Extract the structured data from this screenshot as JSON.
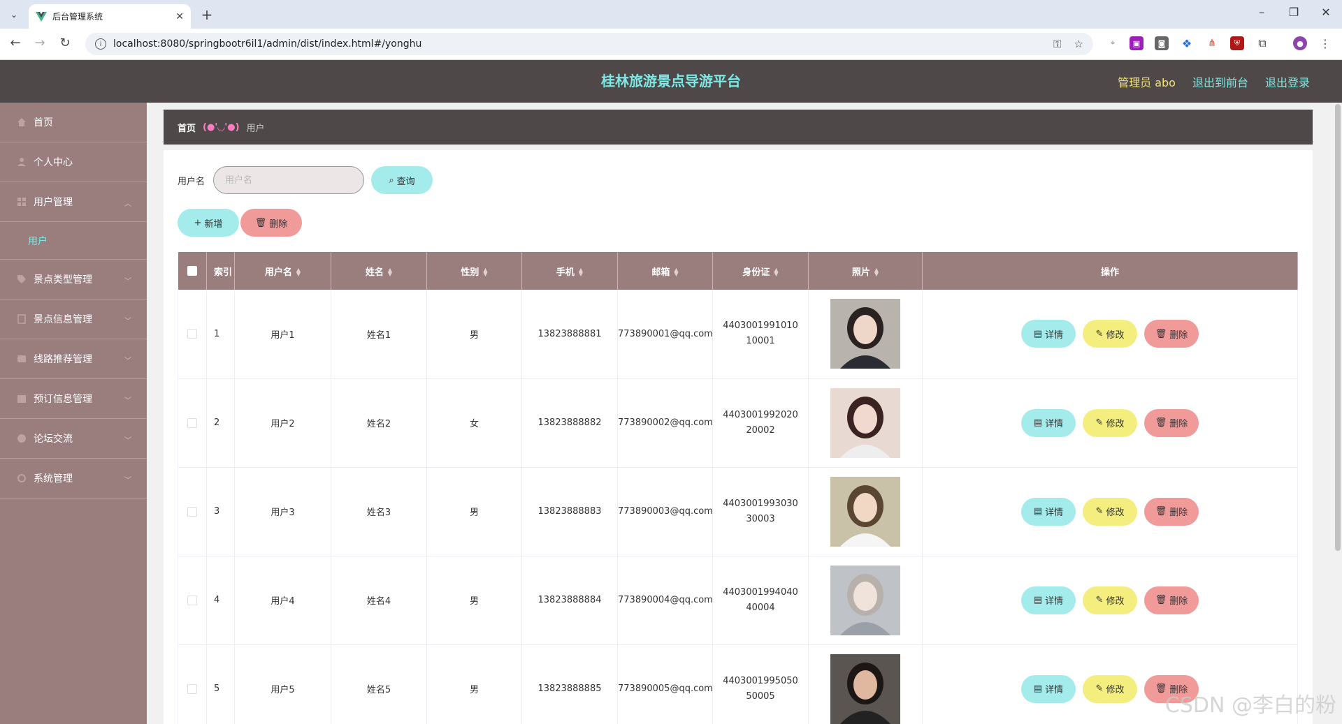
{
  "browser": {
    "tab_title": "后台管理系统",
    "url": "localhost:8080/springbootr6il1/admin/dist/index.html#/yonghu"
  },
  "header": {
    "title": "桂林旅游景点导游平台",
    "admin_label": "管理员 abo",
    "to_front": "退出到前台",
    "logout": "退出登录"
  },
  "sidebar": {
    "items": [
      {
        "label": "首页",
        "icon": "home-icon"
      },
      {
        "label": "个人中心",
        "icon": "user-icon"
      },
      {
        "label": "用户管理",
        "icon": "grid-icon",
        "expanded": true
      },
      {
        "label": "景点类型管理",
        "icon": "tag-icon"
      },
      {
        "label": "景点信息管理",
        "icon": "document-icon"
      },
      {
        "label": "线路推荐管理",
        "icon": "route-icon"
      },
      {
        "label": "预订信息管理",
        "icon": "calendar-icon"
      },
      {
        "label": "论坛交流",
        "icon": "chat-icon"
      },
      {
        "label": "系统管理",
        "icon": "settings-icon"
      }
    ],
    "submenu": {
      "label": "用户"
    }
  },
  "breadcrumb": {
    "home": "首页",
    "separator": "(●'◡'●)",
    "current": "用户"
  },
  "search": {
    "label": "用户名",
    "placeholder": "用户名",
    "query_button": "查询"
  },
  "actions": {
    "add": "新增",
    "delete": "删除"
  },
  "table": {
    "columns": [
      "索引",
      "用户名",
      "姓名",
      "性别",
      "手机",
      "邮箱",
      "身份证",
      "照片",
      "操作"
    ],
    "rows": [
      {
        "index": "1",
        "username": "用户1",
        "name": "姓名1",
        "gender": "男",
        "phone": "13823888881",
        "email": "773890001@qq.com",
        "idcard": "440300199101010001"
      },
      {
        "index": "2",
        "username": "用户2",
        "name": "姓名2",
        "gender": "女",
        "phone": "13823888882",
        "email": "773890002@qq.com",
        "idcard": "440300199202020002"
      },
      {
        "index": "3",
        "username": "用户3",
        "name": "姓名3",
        "gender": "男",
        "phone": "13823888883",
        "email": "773890003@qq.com",
        "idcard": "440300199303030003"
      },
      {
        "index": "4",
        "username": "用户4",
        "name": "姓名4",
        "gender": "男",
        "phone": "13823888884",
        "email": "773890004@qq.com",
        "idcard": "440300199404040004"
      },
      {
        "index": "5",
        "username": "用户5",
        "name": "姓名5",
        "gender": "男",
        "phone": "13823888885",
        "email": "773890005@qq.com",
        "idcard": "440300199505050005"
      }
    ],
    "row_actions": {
      "detail": "详情",
      "edit": "修改",
      "delete": "删除"
    }
  },
  "watermark": "CSDN @李白的粉",
  "colors": {
    "header_bg": "#4e4848",
    "sidebar_bg": "#9a7d7d",
    "title_cyan": "#7de8e4",
    "admin_yellow": "#f3e27a",
    "btn_cyan": "#a4ecec",
    "btn_yellow": "#f3ee7e",
    "btn_pink": "#f19a9a"
  }
}
